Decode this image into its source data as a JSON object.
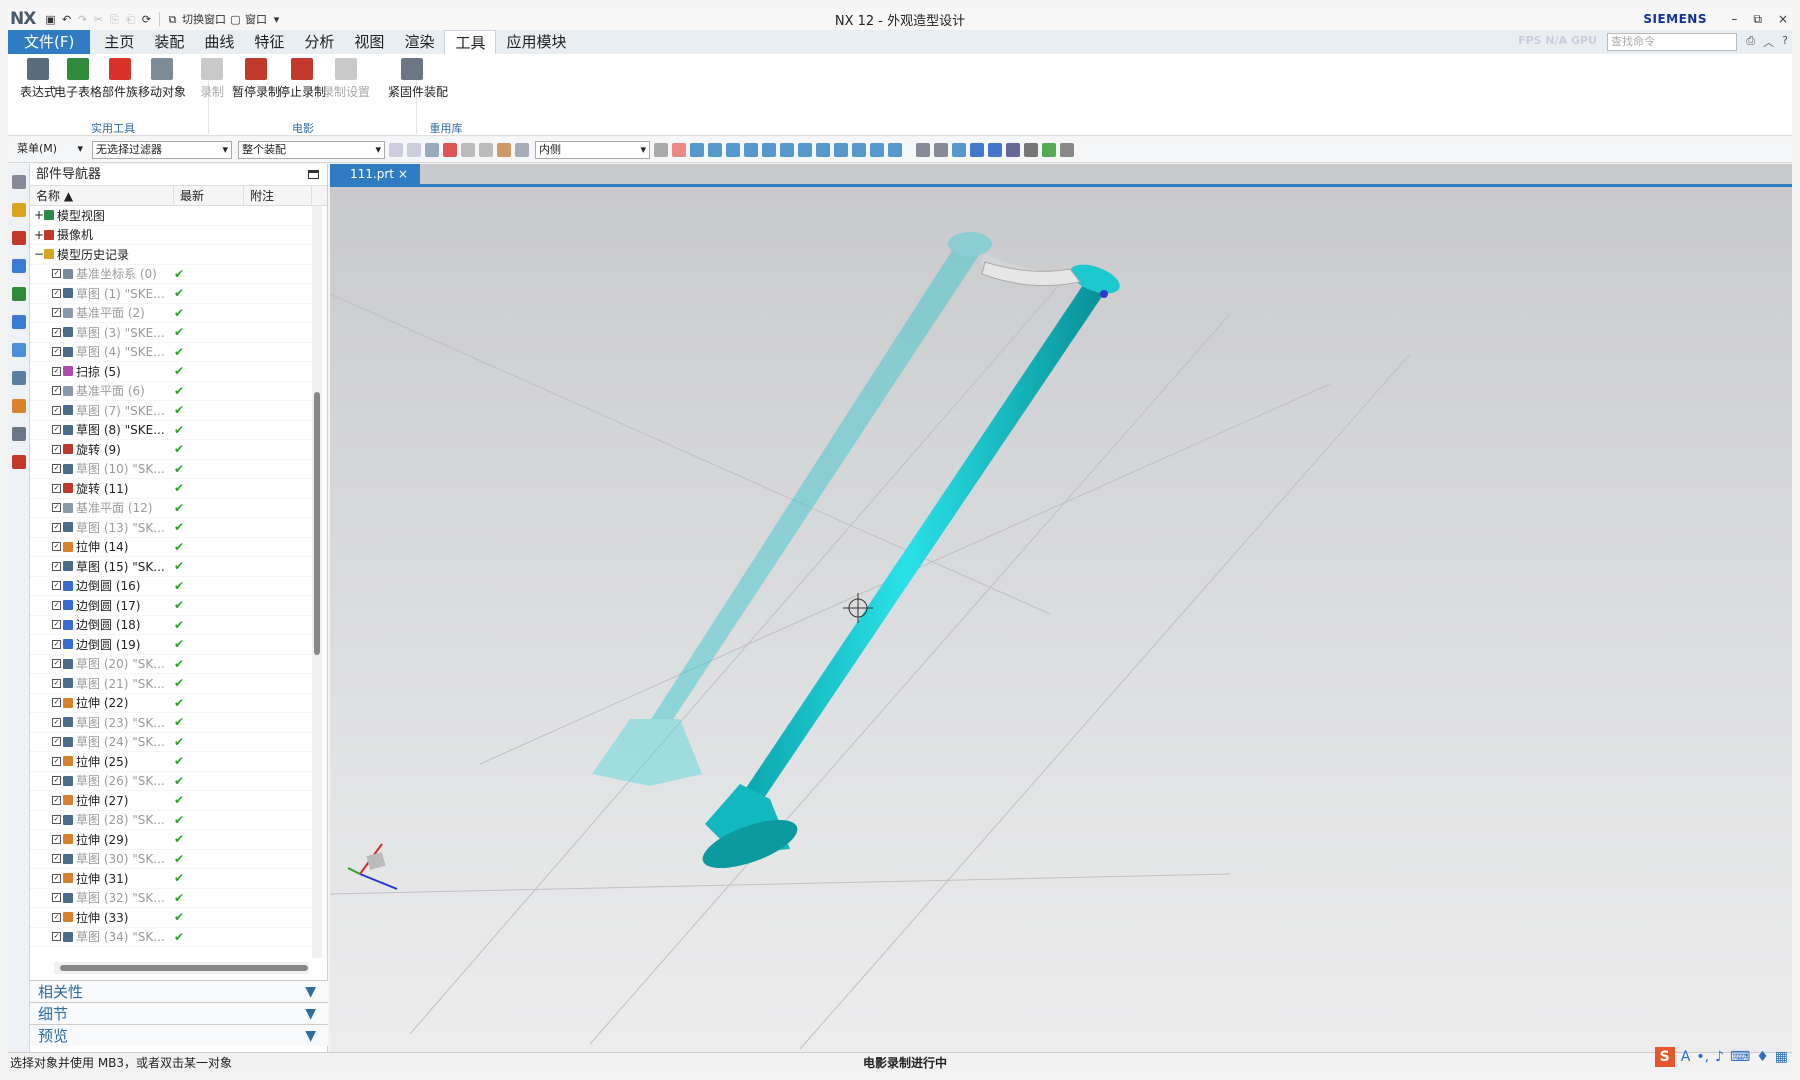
{
  "title_bar": {
    "logo": "NX",
    "quick_access": [
      "switch-window",
      "window"
    ],
    "switch_window_label": "切换窗口",
    "window_label": "窗口",
    "window_title": "NX 12 - 外观造型设计",
    "brand": "SIEMENS",
    "win_controls": [
      "–",
      "⧉",
      "×"
    ]
  },
  "menu": {
    "file": "文件(F)",
    "tabs": [
      "主页",
      "装配",
      "曲线",
      "特征",
      "分析",
      "视图",
      "渲染",
      "工具",
      "应用模块"
    ],
    "active": "工具",
    "search_placeholder": "查找命令",
    "fps_text": "FPS N/A GPU"
  },
  "ribbon": {
    "groups": [
      {
        "name": "实用工具"
      },
      {
        "name": "电影"
      },
      {
        "name": "重用库"
      }
    ],
    "buttons": [
      {
        "label": "表达式",
        "icon": "expression-icon",
        "color": "#5a6b7c",
        "enabled": true
      },
      {
        "label": "电子表格",
        "icon": "spreadsheet-icon",
        "color": "#2e8b3a",
        "enabled": true
      },
      {
        "label": "部件族",
        "icon": "part-family-icon",
        "color": "#d9322b",
        "enabled": true
      },
      {
        "label": "移动对象",
        "icon": "move-object-icon",
        "color": "#7d8b99",
        "enabled": true
      },
      {
        "label": "录制",
        "icon": "record-icon",
        "color": "#c9c9c9",
        "enabled": false
      },
      {
        "label": "暂停录制",
        "icon": "pause-record-icon",
        "color": "#c0392b",
        "enabled": true
      },
      {
        "label": "停止录制",
        "icon": "stop-record-icon",
        "color": "#c0392b",
        "enabled": true
      },
      {
        "label": "录制设置",
        "icon": "record-settings-icon",
        "color": "#c9c9c9",
        "enabled": false
      },
      {
        "label": "紧固件装配",
        "icon": "fastener-assembly-icon",
        "color": "#6b7785",
        "enabled": true
      }
    ]
  },
  "toolbar": {
    "menu_label": "菜单(M)",
    "filter": "无选择过滤器",
    "scope": "整个装配",
    "snap": "内侧"
  },
  "navigator": {
    "title": "部件导航器",
    "columns": [
      "名称",
      "最新",
      "附注"
    ],
    "top_nodes": [
      {
        "label": "模型视图",
        "icon_color": "#2a8a4a"
      },
      {
        "label": "摄像机",
        "icon_color": "#c0392b"
      },
      {
        "label": "模型历史记录",
        "icon_color": "#d9a520"
      }
    ],
    "features": [
      {
        "label": "基准坐标系 (0)",
        "dim": true,
        "color": "#7a8a9a"
      },
      {
        "label": "草图 (1) \"SKE...",
        "dim": true,
        "color": "#4b6b8a"
      },
      {
        "label": "基准平面 (2)",
        "dim": true,
        "color": "#8a9aaa"
      },
      {
        "label": "草图 (3) \"SKE...",
        "dim": true,
        "color": "#4b6b8a"
      },
      {
        "label": "草图 (4) \"SKE...",
        "dim": true,
        "color": "#4b6b8a"
      },
      {
        "label": "扫掠 (5)",
        "dim": false,
        "color": "#b04ab0"
      },
      {
        "label": "基准平面 (6)",
        "dim": true,
        "color": "#8a9aaa"
      },
      {
        "label": "草图 (7) \"SKE...",
        "dim": true,
        "color": "#4b6b8a"
      },
      {
        "label": "草图 (8) \"SKE...",
        "dim": false,
        "color": "#4b6b8a"
      },
      {
        "label": "旋转 (9)",
        "dim": false,
        "color": "#c0392b"
      },
      {
        "label": "草图 (10) \"SK...",
        "dim": true,
        "color": "#4b6b8a"
      },
      {
        "label": "旋转 (11)",
        "dim": false,
        "color": "#c0392b"
      },
      {
        "label": "基准平面 (12)",
        "dim": true,
        "color": "#8a9aaa"
      },
      {
        "label": "草图 (13) \"SK...",
        "dim": true,
        "color": "#4b6b8a"
      },
      {
        "label": "拉伸 (14)",
        "dim": false,
        "color": "#d9822b"
      },
      {
        "label": "草图 (15) \"SK...",
        "dim": false,
        "color": "#4b6b8a"
      },
      {
        "label": "边倒圆 (16)",
        "dim": false,
        "color": "#3a6bd0"
      },
      {
        "label": "边倒圆 (17)",
        "dim": false,
        "color": "#3a6bd0"
      },
      {
        "label": "边倒圆 (18)",
        "dim": false,
        "color": "#3a6bd0"
      },
      {
        "label": "边倒圆 (19)",
        "dim": false,
        "color": "#3a6bd0"
      },
      {
        "label": "草图 (20) \"SK...",
        "dim": true,
        "color": "#4b6b8a"
      },
      {
        "label": "草图 (21) \"SK...",
        "dim": true,
        "color": "#4b6b8a"
      },
      {
        "label": "拉伸 (22)",
        "dim": false,
        "color": "#d9822b"
      },
      {
        "label": "草图 (23) \"SK...",
        "dim": true,
        "color": "#4b6b8a"
      },
      {
        "label": "草图 (24) \"SK...",
        "dim": true,
        "color": "#4b6b8a"
      },
      {
        "label": "拉伸 (25)",
        "dim": false,
        "color": "#d9822b"
      },
      {
        "label": "草图 (26) \"SK...",
        "dim": true,
        "color": "#4b6b8a"
      },
      {
        "label": "拉伸 (27)",
        "dim": false,
        "color": "#d9822b"
      },
      {
        "label": "草图 (28) \"SK...",
        "dim": true,
        "color": "#4b6b8a"
      },
      {
        "label": "拉伸 (29)",
        "dim": false,
        "color": "#d9822b"
      },
      {
        "label": "草图 (30) \"SK...",
        "dim": true,
        "color": "#4b6b8a"
      },
      {
        "label": "拉伸 (31)",
        "dim": false,
        "color": "#d9822b"
      },
      {
        "label": "草图 (32) \"SK...",
        "dim": true,
        "color": "#4b6b8a"
      },
      {
        "label": "拉伸 (33)",
        "dim": false,
        "color": "#d9822b"
      },
      {
        "label": "草图 (34) \"SK...",
        "dim": true,
        "color": "#4b6b8a"
      }
    ],
    "checkmark": "✔",
    "panels": [
      "相关性",
      "细节",
      "预览"
    ]
  },
  "graphics": {
    "tab_label": "111.prt",
    "model_color": "#19c9cf"
  },
  "status": {
    "left": "选择对象并使用 MB3，或者双击某一对象",
    "center": "电影录制进行中",
    "ime_logo": "S"
  }
}
